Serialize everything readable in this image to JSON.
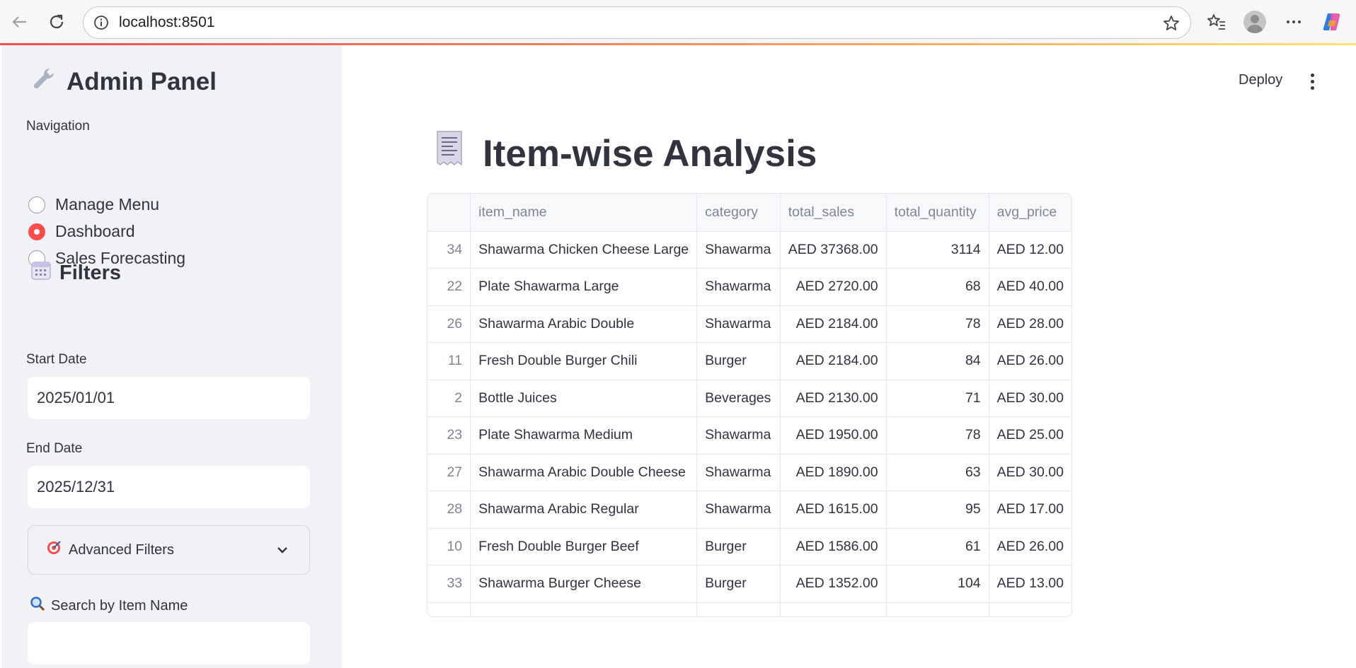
{
  "browser": {
    "url": "localhost:8501"
  },
  "colors": {
    "accent": "#ff4b4b",
    "sidebar_bg": "#f0f2f6",
    "text": "#31333f"
  },
  "sidebar": {
    "title": "Admin Panel",
    "title_icon": "wrench-icon",
    "nav_label": "Navigation",
    "nav_options": [
      "Manage Menu",
      "Dashboard",
      "Sales Forecasting"
    ],
    "nav_selected": "Dashboard",
    "filters_title": "Filters",
    "filters_icon": "calendar-icon",
    "start_date_label": "Start Date",
    "start_date_value": "2025/01/01",
    "end_date_label": "End Date",
    "end_date_value": "2025/12/31",
    "advanced_filters_label": "Advanced Filters",
    "search_label": "Search by Item Name",
    "search_value": ""
  },
  "header": {
    "deploy_label": "Deploy"
  },
  "main": {
    "title": "Item-wise Analysis",
    "title_icon": "receipt-icon",
    "table": {
      "columns": [
        "",
        "item_name",
        "category",
        "total_sales",
        "total_quantity",
        "avg_price"
      ],
      "rows": [
        [
          "34",
          "Shawarma Chicken Cheese Large",
          "Shawarma",
          "AED 37368.00",
          "3114",
          "AED 12.00"
        ],
        [
          "22",
          "Plate Shawarma Large",
          "Shawarma",
          "AED 2720.00",
          "68",
          "AED 40.00"
        ],
        [
          "26",
          "Shawarma Arabic Double",
          "Shawarma",
          "AED 2184.00",
          "78",
          "AED 28.00"
        ],
        [
          "11",
          "Fresh Double Burger Chili",
          "Burger",
          "AED 2184.00",
          "84",
          "AED 26.00"
        ],
        [
          "2",
          "Bottle Juices",
          "Beverages",
          "AED 2130.00",
          "71",
          "AED 30.00"
        ],
        [
          "23",
          "Plate Shawarma Medium",
          "Shawarma",
          "AED 1950.00",
          "78",
          "AED 25.00"
        ],
        [
          "27",
          "Shawarma Arabic Double Cheese",
          "Shawarma",
          "AED 1890.00",
          "63",
          "AED 30.00"
        ],
        [
          "28",
          "Shawarma Arabic Regular",
          "Shawarma",
          "AED 1615.00",
          "95",
          "AED 17.00"
        ],
        [
          "10",
          "Fresh Double Burger Beef",
          "Burger",
          "AED 1586.00",
          "61",
          "AED 26.00"
        ],
        [
          "33",
          "Shawarma Burger Cheese",
          "Burger",
          "AED 1352.00",
          "104",
          "AED 13.00"
        ]
      ]
    }
  }
}
